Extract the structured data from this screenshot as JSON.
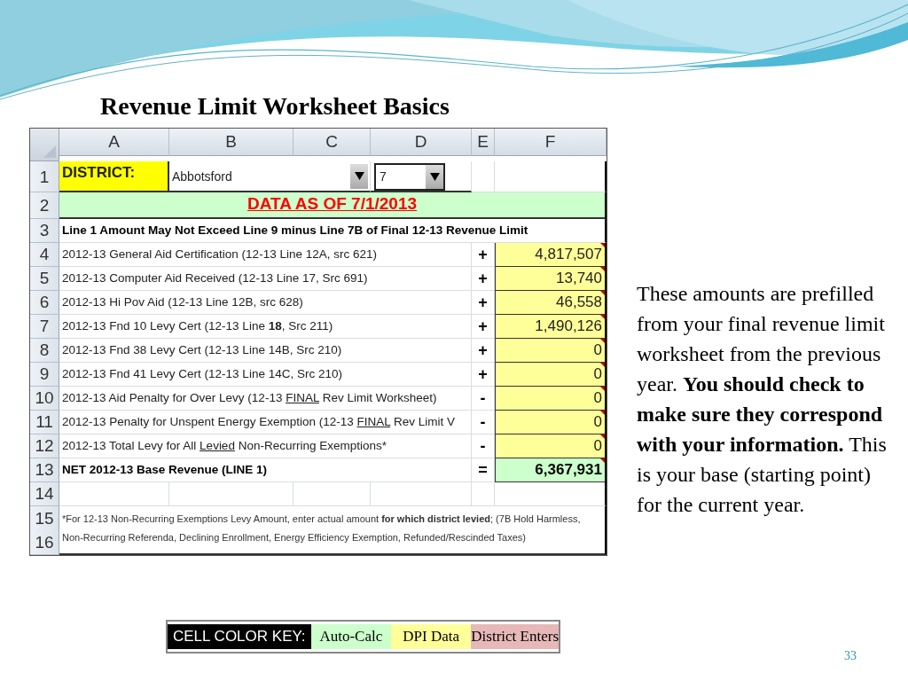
{
  "title": "Revenue Limit Worksheet Basics",
  "sheet": {
    "columns": [
      "A",
      "B",
      "C",
      "D",
      "E",
      "F"
    ],
    "rows": [
      {
        "kind": "district",
        "number": "1",
        "label": "DISTRICT:",
        "district_name": "Abbotsford",
        "choice": "7"
      },
      {
        "kind": "banner",
        "number": "2",
        "text": "DATA AS OF 7/1/2013"
      },
      {
        "kind": "heading",
        "number": "3",
        "text": "Line 1 Amount May Not Exceed Line 9 minus Line 7B of Final 12-13 Revenue Limit"
      },
      {
        "kind": "item",
        "number": "4",
        "label": [
          {
            "text": "2012-13 General Aid Certification (12-13 Line 12A, src 621)"
          }
        ],
        "sign": "+",
        "value": "4,817,507"
      },
      {
        "kind": "item",
        "number": "5",
        "label": [
          {
            "text": "2012-13 Computer Aid Received (12-13 Line 17, Src 691)"
          }
        ],
        "sign": "+",
        "value": "13,740"
      },
      {
        "kind": "item",
        "number": "6",
        "label": [
          {
            "text": "2012-13 Hi Pov Aid (12-13 Line 12B, src 628)"
          }
        ],
        "sign": "+",
        "value": "46,558"
      },
      {
        "kind": "item",
        "number": "7",
        "label": [
          {
            "text": "2012-13 Fnd 10 Levy Cert (12-13 Line "
          },
          {
            "text": "18",
            "bold": true
          },
          {
            "text": ", Src 211)"
          }
        ],
        "sign": "+",
        "value": "1,490,126"
      },
      {
        "kind": "item",
        "number": "8",
        "label": [
          {
            "text": "2012-13 Fnd 38 Levy Cert (12-13 Line 14B, Src 210)"
          }
        ],
        "sign": "+",
        "value": "0"
      },
      {
        "kind": "item",
        "number": "9",
        "label": [
          {
            "text": "2012-13 Fnd 41 Levy Cert (12-13 Line 14C, Src 210)"
          }
        ],
        "sign": "+",
        "value": "0"
      },
      {
        "kind": "item",
        "number": "10",
        "label": [
          {
            "text": "2012-13 Aid Penalty for Over Levy (12-13 "
          },
          {
            "text": "FINAL",
            "underline": true
          },
          {
            "text": " Rev Limit Worksheet)"
          }
        ],
        "sign": "-",
        "value": "0"
      },
      {
        "kind": "item",
        "number": "11",
        "label": [
          {
            "text": "2012-13 Penalty for Unspent Energy Exemption (12-13 "
          },
          {
            "text": "FINAL",
            "underline": true
          },
          {
            "text": " Rev Limit V"
          }
        ],
        "sign": "-",
        "value": "0"
      },
      {
        "kind": "item",
        "number": "12",
        "label": [
          {
            "text": "2012-13 Total Levy for All "
          },
          {
            "text": "Levied",
            "underline": true
          },
          {
            "text": " Non-Recurring Exemptions*"
          }
        ],
        "sign": "-",
        "value": "0"
      },
      {
        "kind": "total",
        "number": "13",
        "label": [
          {
            "text": "NET 2012-13 Base Revenue (LINE 1)"
          }
        ],
        "sign": "=",
        "value": "6,367,931"
      },
      {
        "kind": "blank",
        "number": "14"
      },
      {
        "kind": "note",
        "numbers": [
          "15",
          "16"
        ],
        "text": "*For 12-13 Non-Recurring Exemptions Levy Amount, enter actual amount **for which district levied**; (7B Hold Harmless, Non-Recurring Referenda, Declining Enrollment, Energy Efficiency Exemption, Refunded/Rescinded Taxes)"
      }
    ]
  },
  "color_key": {
    "label": "CELL COLOR KEY:",
    "items": [
      {
        "text": "Auto-Calc",
        "color": "#ccffcc"
      },
      {
        "text": "DPI Data",
        "color": "#ffff99"
      },
      {
        "text": "District Enters",
        "color": "#e6b8b7"
      }
    ]
  },
  "explanation": "These amounts are prefilled from your final revenue limit worksheet from the previous year. **You should check to make sure they correspond with your information.**  This is your base (starting point) for the current year.",
  "page_number": "33"
}
